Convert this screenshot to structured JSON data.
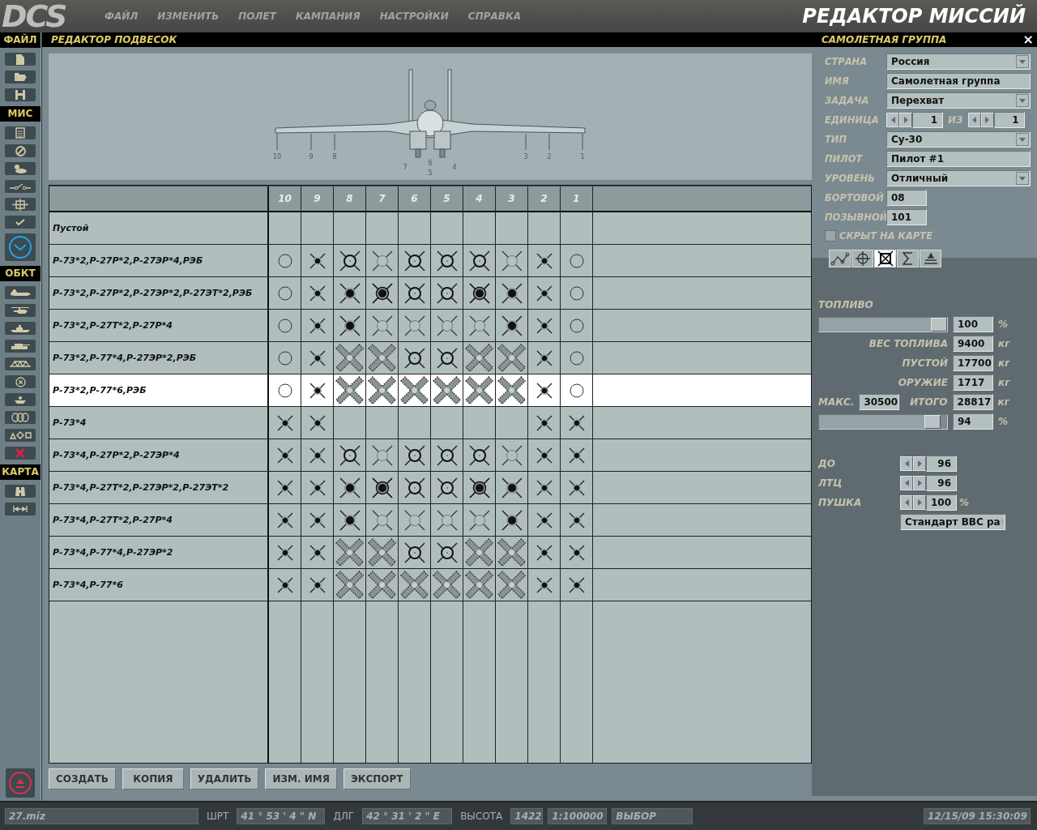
{
  "menu_bar": {
    "logo": "DCS",
    "items": [
      "ФАЙЛ",
      "ИЗМЕНИТЬ",
      "ПОЛЕТ",
      "КАМПАНИЯ",
      "НАСТРОЙКИ",
      "СПРАВКА"
    ],
    "title": "РЕДАКТОР МИССИЙ"
  },
  "toolbar": {
    "sections": [
      {
        "label": "ФАЙЛ",
        "buttons": [
          {
            "kind": "new"
          },
          {
            "kind": "open"
          },
          {
            "kind": "save"
          }
        ]
      },
      {
        "label": "МИС",
        "buttons": [
          {
            "kind": "clipboard"
          },
          {
            "kind": "forbidden"
          },
          {
            "kind": "weather"
          },
          {
            "kind": "trigger"
          },
          {
            "kind": "target"
          },
          {
            "kind": "check"
          },
          {
            "kind": "clock"
          }
        ]
      },
      {
        "label": "ОБКТ",
        "buttons": [
          {
            "kind": "plane"
          },
          {
            "kind": "helicopter"
          },
          {
            "kind": "ship"
          },
          {
            "kind": "tank"
          },
          {
            "kind": "bridge"
          },
          {
            "kind": "static"
          },
          {
            "kind": "ground"
          },
          {
            "kind": "zones"
          },
          {
            "kind": "shapes"
          },
          {
            "kind": "delete"
          }
        ]
      },
      {
        "label": "КАРТА",
        "buttons": [
          {
            "kind": "binoculars"
          },
          {
            "kind": "ruler"
          }
        ]
      }
    ],
    "bottom_button": {
      "kind": "eject"
    }
  },
  "loadout_editor": {
    "title": "РЕДАКТОР ПОДВЕСОК",
    "stations": [
      "10",
      "9",
      "8",
      "7",
      "6",
      "5",
      "4",
      "3",
      "2",
      "1"
    ],
    "table": {
      "columns": [
        "10",
        "9",
        "8",
        "7",
        "6",
        "5",
        "4",
        "3",
        "2",
        "1"
      ],
      "rows": [
        {
          "name": "Пустой",
          "selected": false
        },
        {
          "name": "Р-73*2,Р-27Р*2,Р-27ЭР*4,РЭБ",
          "selected": false,
          "cells": [
            {
              "kind": "circle"
            },
            {
              "kind": "small"
            },
            {
              "kind": "ring"
            },
            {
              "kind": "light"
            },
            {
              "kind": "ring"
            },
            {
              "kind": "ring"
            },
            {
              "kind": "ring"
            },
            {
              "kind": "light"
            },
            {
              "kind": "small"
            },
            {
              "kind": "circle"
            }
          ]
        },
        {
          "name": "Р-73*2,Р-27Р*2,Р-27ЭР*2,Р-27ЭТ*2,РЭБ",
          "selected": false,
          "cells": [
            {
              "kind": "circle"
            },
            {
              "kind": "small"
            },
            {
              "kind": "dot"
            },
            {
              "kind": "bigdot"
            },
            {
              "kind": "ring"
            },
            {
              "kind": "ring"
            },
            {
              "kind": "bigdot"
            },
            {
              "kind": "dot"
            },
            {
              "kind": "small"
            },
            {
              "kind": "circle"
            }
          ]
        },
        {
          "name": "Р-73*2,Р-27Т*2,Р-27Р*4",
          "selected": false,
          "cells": [
            {
              "kind": "circle"
            },
            {
              "kind": "small"
            },
            {
              "kind": "dot"
            },
            {
              "kind": "light"
            },
            {
              "kind": "light"
            },
            {
              "kind": "light"
            },
            {
              "kind": "light"
            },
            {
              "kind": "dot"
            },
            {
              "kind": "small"
            },
            {
              "kind": "circle"
            }
          ]
        },
        {
          "name": "Р-73*2,Р-77*4,Р-27ЭР*2,РЭБ",
          "selected": false,
          "cells": [
            {
              "kind": "circle"
            },
            {
              "kind": "small"
            },
            {
              "kind": "pod"
            },
            {
              "kind": "pod"
            },
            {
              "kind": "ring"
            },
            {
              "kind": "ring"
            },
            {
              "kind": "pod"
            },
            {
              "kind": "pod"
            },
            {
              "kind": "small"
            },
            {
              "kind": "circle"
            }
          ]
        },
        {
          "name": "Р-73*2,Р-77*6,РЭБ",
          "selected": true,
          "cells": [
            {
              "kind": "circle"
            },
            {
              "kind": "small"
            },
            {
              "kind": "pod"
            },
            {
              "kind": "pod"
            },
            {
              "kind": "pod"
            },
            {
              "kind": "pod"
            },
            {
              "kind": "pod"
            },
            {
              "kind": "pod"
            },
            {
              "kind": "small"
            },
            {
              "kind": "circle"
            }
          ]
        },
        {
          "name": "Р-73*4",
          "selected": false,
          "cells": [
            {
              "kind": "small"
            },
            {
              "kind": "small"
            },
            {},
            {},
            {},
            {},
            {},
            {},
            {
              "kind": "small"
            },
            {
              "kind": "small"
            }
          ]
        },
        {
          "name": "Р-73*4,Р-27Р*2,Р-27ЭР*4",
          "selected": false,
          "cells": [
            {
              "kind": "small"
            },
            {
              "kind": "small"
            },
            {
              "kind": "ring"
            },
            {
              "kind": "light"
            },
            {
              "kind": "ring"
            },
            {
              "kind": "ring"
            },
            {
              "kind": "ring"
            },
            {
              "kind": "light"
            },
            {
              "kind": "small"
            },
            {
              "kind": "small"
            }
          ]
        },
        {
          "name": "Р-73*4,Р-27Т*2,Р-27ЭР*2,Р-27ЭТ*2",
          "selected": false,
          "cells": [
            {
              "kind": "small"
            },
            {
              "kind": "small"
            },
            {
              "kind": "dot"
            },
            {
              "kind": "bigdot"
            },
            {
              "kind": "ring"
            },
            {
              "kind": "ring"
            },
            {
              "kind": "bigdot"
            },
            {
              "kind": "dot"
            },
            {
              "kind": "small"
            },
            {
              "kind": "small"
            }
          ]
        },
        {
          "name": "Р-73*4,Р-27Т*2,Р-27Р*4",
          "selected": false,
          "cells": [
            {
              "kind": "small"
            },
            {
              "kind": "small"
            },
            {
              "kind": "dot"
            },
            {
              "kind": "light"
            },
            {
              "kind": "light"
            },
            {
              "kind": "light"
            },
            {
              "kind": "light"
            },
            {
              "kind": "dot"
            },
            {
              "kind": "small"
            },
            {
              "kind": "small"
            }
          ]
        },
        {
          "name": "Р-73*4,Р-77*4,Р-27ЭР*2",
          "selected": false,
          "cells": [
            {
              "kind": "small"
            },
            {
              "kind": "small"
            },
            {
              "kind": "pod"
            },
            {
              "kind": "pod"
            },
            {
              "kind": "ring"
            },
            {
              "kind": "ring"
            },
            {
              "kind": "pod"
            },
            {
              "kind": "pod"
            },
            {
              "kind": "small"
            },
            {
              "kind": "small"
            }
          ]
        },
        {
          "name": "Р-73*4,Р-77*6",
          "selected": false,
          "cells": [
            {
              "kind": "small"
            },
            {
              "kind": "small"
            },
            {
              "kind": "pod"
            },
            {
              "kind": "pod"
            },
            {
              "kind": "pod"
            },
            {
              "kind": "pod"
            },
            {
              "kind": "pod"
            },
            {
              "kind": "pod"
            },
            {
              "kind": "small"
            },
            {
              "kind": "small"
            }
          ]
        }
      ]
    },
    "buttons": [
      "СОЗДАТЬ",
      "КОПИЯ",
      "УДАЛИТЬ",
      "ИЗМ. ИМЯ",
      "ЭКСПОРТ"
    ]
  },
  "group_panel": {
    "title": "САМОЛЕТНАЯ ГРУППА",
    "close": "×",
    "fields": [
      {
        "label": "СТРАНА",
        "kind": "dropdown",
        "value": "Россия"
      },
      {
        "label": "ИМЯ",
        "kind": "text",
        "value": "Самолетная группа"
      },
      {
        "label": "ЗАДАЧА",
        "kind": "dropdown",
        "value": "Перехват"
      },
      {
        "label": "ЕДИНИЦА",
        "kind": "unit",
        "value": "1",
        "of_label": "ИЗ",
        "total": "1"
      },
      {
        "label": "ТИП",
        "kind": "dropdown",
        "value": "Су-30"
      },
      {
        "label": "ПИЛОТ",
        "kind": "text",
        "value": "Пилот #1"
      },
      {
        "label": "УРОВЕНЬ",
        "kind": "dropdown",
        "value": "Отличный"
      },
      {
        "label": "БОРТОВОЙ",
        "kind": "short",
        "value": "08"
      },
      {
        "label": "ПОЗЫВНОЙ",
        "kind": "short",
        "value": "101"
      }
    ],
    "hidden_on_map": {
      "label": "СКРЫТ НА КАРТЕ",
      "checked": false
    },
    "tabs": [
      {
        "kind": "route",
        "selected": false
      },
      {
        "kind": "target",
        "selected": false
      },
      {
        "kind": "payload",
        "selected": true
      },
      {
        "kind": "summary",
        "selected": false
      },
      {
        "kind": "triggers",
        "selected": false
      }
    ],
    "payload": {
      "fuel_label": "ТОПЛИВО",
      "fuel": {
        "level": 1.0,
        "value": "100",
        "unit": "%"
      },
      "weights": [
        {
          "label": "ВЕС ТОПЛИВА",
          "value": "9400",
          "unit": "кг"
        },
        {
          "label": "ПУСТОЙ",
          "value": "17700",
          "unit": "кг"
        },
        {
          "label": "ОРУЖИЕ",
          "value": "1717",
          "unit": "кг"
        }
      ],
      "max_label": "МАКС.",
      "max_value": "30500",
      "total": {
        "label": "ИТОГО",
        "value": "28817",
        "unit": "кг"
      },
      "load": {
        "level": 0.94,
        "value": "94",
        "unit": "%"
      },
      "counters": [
        {
          "label": "ДО",
          "value": "96"
        },
        {
          "label": "ЛТЦ",
          "value": "96"
        },
        {
          "label": "ПУШКА",
          "value": "100",
          "unit": "%"
        }
      ],
      "ammo_dropdown": "Стандарт ВВС ра"
    }
  },
  "status_bar": {
    "file": "27.miz",
    "lat_label": "ШРТ",
    "lat": "41 ° 53 ' 4 \" N",
    "lon_label": "ДЛГ",
    "lon": "42 ° 31 ' 2 \" E",
    "alt_label": "ВЫСОТА",
    "alt": "1422",
    "scale": "1:100000",
    "mode": "ВЫБОР",
    "datetime": "12/15/09 15:30:09"
  }
}
